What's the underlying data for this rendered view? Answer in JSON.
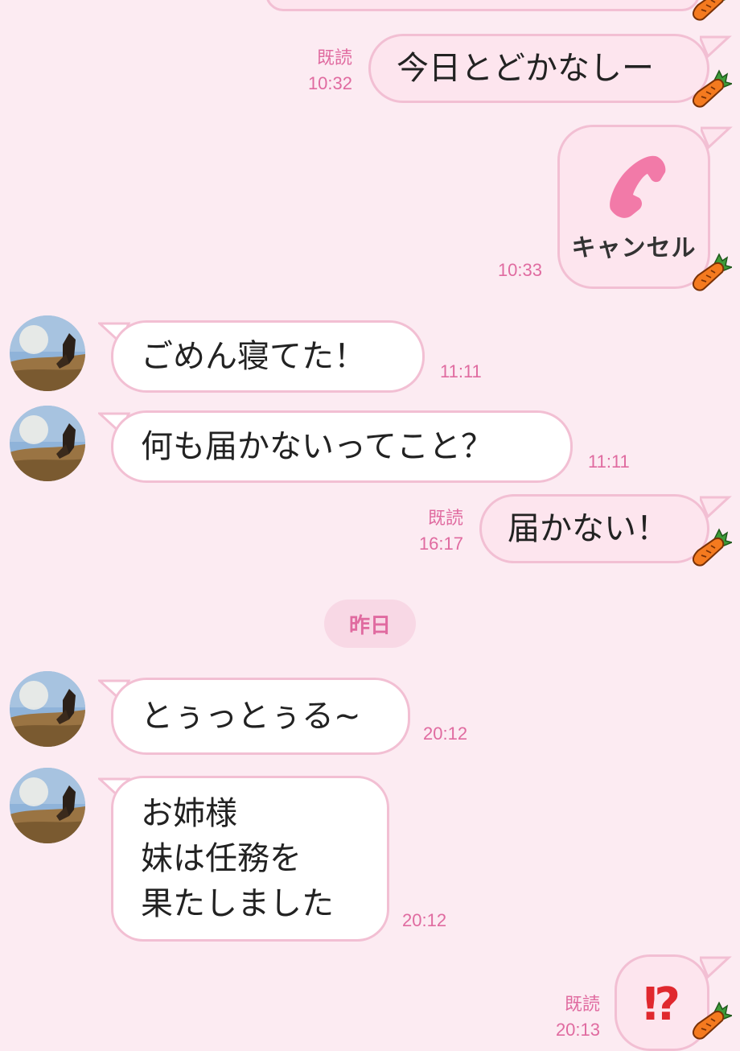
{
  "colors": {
    "background": "#fcebf2",
    "outgoing_bubble": "#fde5ee",
    "incoming_bubble": "#ffffff",
    "bubble_border": "#f2bfd3",
    "meta_text": "#e06ba0",
    "call_icon": "#f27aa8",
    "exclaim_icon": "#e0282e"
  },
  "messages": [
    {
      "id": "m1",
      "direction": "out",
      "text": "今日とどかなしー",
      "read": "既読",
      "time": "10:32",
      "sticker_icon": "carrot-icon"
    },
    {
      "id": "m2",
      "direction": "out",
      "type": "call",
      "icon": "phone-icon",
      "text": "キャンセル",
      "time": "10:33",
      "sticker_icon": "carrot-icon"
    },
    {
      "id": "m3",
      "direction": "in",
      "text": "ごめん寝てた！",
      "time": "11:11"
    },
    {
      "id": "m4",
      "direction": "in",
      "text": "何も届かないってこと？",
      "time": "11:11"
    },
    {
      "id": "m5",
      "direction": "out",
      "text": "届かない！",
      "read": "既読",
      "time": "16:17",
      "sticker_icon": "carrot-icon"
    },
    {
      "id": "m6",
      "direction": "in",
      "text": "とぅっとぅる~",
      "time": "20:12"
    },
    {
      "id": "m7",
      "direction": "in",
      "lines": [
        "お姉様",
        "妹は任務を",
        "果たしました"
      ],
      "time": "20:12"
    },
    {
      "id": "m8",
      "direction": "out",
      "type": "emoji",
      "text": "⁉",
      "read": "既読",
      "time": "20:13",
      "sticker_icon": "carrot-icon"
    }
  ],
  "date_separator": "昨日"
}
